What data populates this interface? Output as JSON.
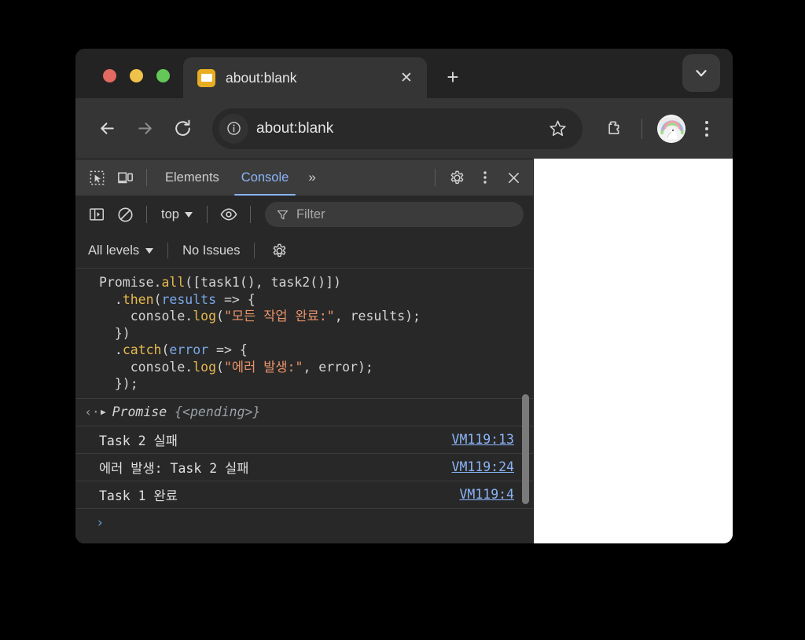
{
  "window": {
    "traffic_lights": [
      "close",
      "minimize",
      "maximize"
    ],
    "colors": {
      "red": "#e36a60",
      "yellow": "#f0c24a",
      "green": "#63c857",
      "favicon": "#e8ad22",
      "devtools_accent": "#8ab4f8",
      "chrome_bg": "#353535",
      "devtools_bg": "#282828"
    }
  },
  "tabstrip": {
    "tab": {
      "title": "about:blank",
      "favicon_name": "generic-page-favicon",
      "close_label": "✕"
    },
    "new_tab_label": "+",
    "tab_list_label": "tab-search"
  },
  "toolbar": {
    "back_label": "←",
    "forward_label": "→",
    "reload_label": "↻",
    "site_info_label": "ⓘ",
    "url": "about:blank",
    "bookmark_label": "☆",
    "extensions_label": "extensions",
    "profile_label": "profile",
    "menu_label": "⋮"
  },
  "devtools": {
    "toolbar": {
      "inspect_label": "inspect-element",
      "device_label": "device-toolbar",
      "tabs": [
        {
          "label": "Elements",
          "active": false
        },
        {
          "label": "Console",
          "active": true
        }
      ],
      "more_tabs_label": "»",
      "settings_label": "⚙",
      "kebab_label": "⋮",
      "close_label": "✕"
    },
    "filterbar": {
      "sidebar_label": "console-sidebar",
      "clear_label": "clear-console",
      "context": "top",
      "eye_label": "live-expressions",
      "filter_placeholder": "Filter"
    },
    "levelbar": {
      "levels": "All levels",
      "issues": "No Issues",
      "settings_label": "issues-settings"
    },
    "console": {
      "input_code_lines": [
        [
          {
            "t": "Promise.",
            "c": "plain"
          },
          {
            "t": "all",
            "c": "method"
          },
          {
            "t": "([task1(), task2()])",
            "c": "plain"
          }
        ],
        [
          {
            "t": "  .",
            "c": "plain"
          },
          {
            "t": "then",
            "c": "method"
          },
          {
            "t": "(",
            "c": "plain"
          },
          {
            "t": "results",
            "c": "param"
          },
          {
            "t": " => {",
            "c": "plain"
          }
        ],
        [
          {
            "t": "    console.",
            "c": "plain"
          },
          {
            "t": "log",
            "c": "method"
          },
          {
            "t": "(",
            "c": "plain"
          },
          {
            "t": "\"모든 작업 완료:\"",
            "c": "string"
          },
          {
            "t": ", results);",
            "c": "plain"
          }
        ],
        [
          {
            "t": "  })",
            "c": "plain"
          }
        ],
        [
          {
            "t": "  .",
            "c": "plain"
          },
          {
            "t": "catch",
            "c": "method"
          },
          {
            "t": "(",
            "c": "plain"
          },
          {
            "t": "error",
            "c": "param"
          },
          {
            "t": " => {",
            "c": "plain"
          }
        ],
        [
          {
            "t": "    console.",
            "c": "plain"
          },
          {
            "t": "log",
            "c": "method"
          },
          {
            "t": "(",
            "c": "plain"
          },
          {
            "t": "\"에러 발생:\"",
            "c": "string"
          },
          {
            "t": ", error);",
            "c": "plain"
          }
        ],
        [
          {
            "t": "  });",
            "c": "plain"
          }
        ]
      ],
      "return_value": {
        "arrow": "‹·",
        "disclosure": "▶",
        "type": "Promise",
        "state": "{<pending>}"
      },
      "messages": [
        {
          "text": "Task 2 실패",
          "source": "VM119:13"
        },
        {
          "text": "에러 발생: Task 2 실패",
          "source": "VM119:24"
        },
        {
          "text": "Task 1 완료",
          "source": "VM119:4"
        }
      ],
      "prompt": "›"
    }
  }
}
